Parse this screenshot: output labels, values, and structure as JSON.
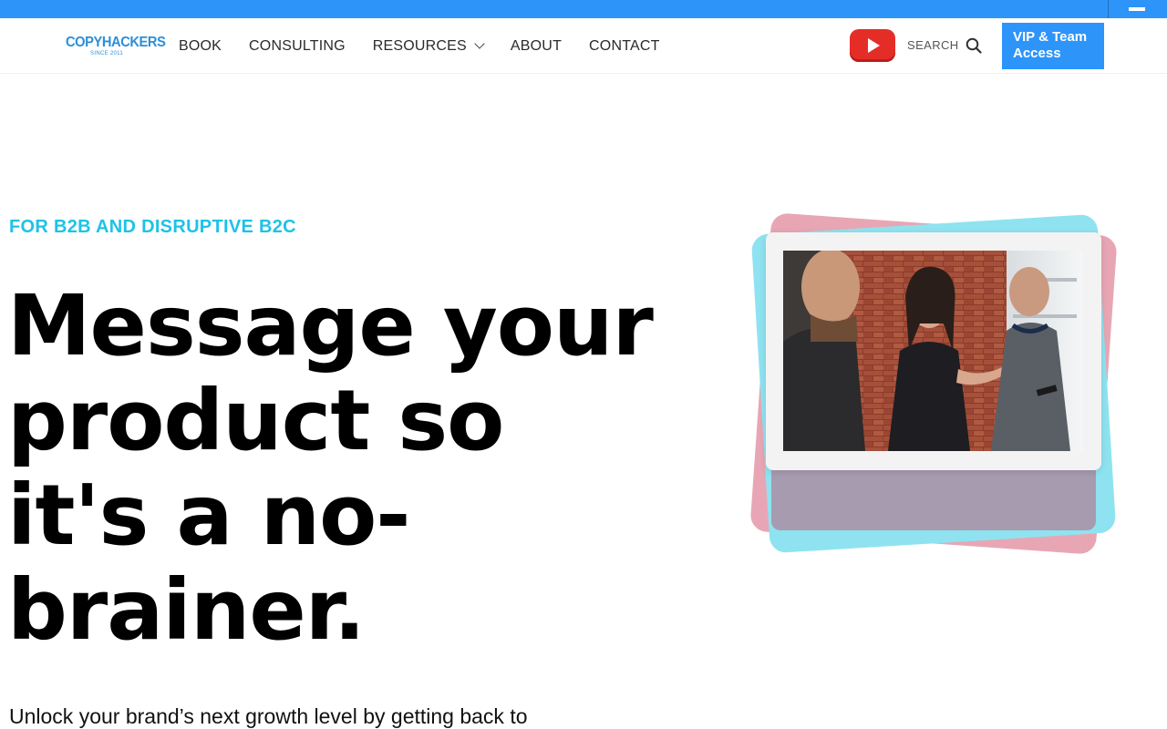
{
  "brand": {
    "name": "COPYHACKERS",
    "tagline": "SINCE 2011",
    "accent": "#2d94f9",
    "eyebrow_color": "#1ec2e8"
  },
  "nav": {
    "items": [
      {
        "label": "BOOK"
      },
      {
        "label": "CONSULTING"
      },
      {
        "label": "RESOURCES"
      },
      {
        "label": "ABOUT"
      },
      {
        "label": "CONTACT"
      }
    ]
  },
  "header": {
    "youtube_icon": "youtube-play-icon",
    "search_label": "SEARCH",
    "search_icon": "magnifier-icon",
    "vip_label": "VIP & Team Access"
  },
  "hero": {
    "eyebrow": "FOR B2B AND DISRUPTIVE B2C",
    "headline_lines": [
      "Message your",
      "product so",
      "it's a no-",
      "brainer."
    ],
    "subtext": "Unlock your brand’s next growth level by getting back to",
    "image_icon": "team-meeting-photo"
  }
}
